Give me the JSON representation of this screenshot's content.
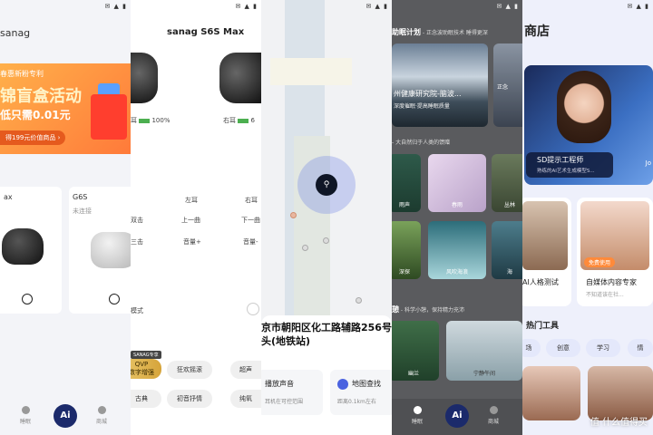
{
  "status_icons": "✉ ▲ ▮",
  "p1": {
    "title": "sanag",
    "banner": {
      "line1": "春惠新粉专利",
      "line2": "锦盲盒活动",
      "line3": "低只需0.01元",
      "cta": "得199元价值商品 ›"
    },
    "devices": [
      {
        "name": "ax",
        "status": ""
      },
      {
        "name": "G6S",
        "status": "未连接"
      }
    ],
    "nav": {
      "sleep": "睡眠",
      "ai": "Ai",
      "mall": "商城"
    }
  },
  "p2": {
    "title": "sanag S6S Max",
    "left_ear": "耳",
    "left_batt": "100%",
    "right_ear": "右耳",
    "right_batt": "6",
    "col_left": "左耳",
    "col_right": "右耳",
    "rows": [
      {
        "label": "双击",
        "left": "上一曲",
        "right": "下一曲"
      },
      {
        "label": "三击",
        "left": "音量+",
        "right": "音量-"
      }
    ],
    "mode_label": "模式",
    "gold_tag": "SANAG专享",
    "chips": [
      "QVP\n数字增强",
      "狂欢摇滚",
      "超声",
      "古典",
      "初音抒情",
      "纯氧"
    ]
  },
  "p3": {
    "address": "京市朝阳区化工路辅路256号\n头(地铁站)",
    "actions": [
      {
        "title": "播放声音",
        "desc": "耳机在可控范围"
      },
      {
        "title": "地图查找",
        "desc": "距离0.1km左右"
      }
    ]
  },
  "p4": {
    "sec1_title": "助眠计划",
    "sec1_sub": " - 正念波助眠技术 睡得更深",
    "hero_title": "州健康研究院-脑波...",
    "hero_desc": "深度催眠·提高睡眠质量",
    "hero_side": "正念",
    "sec2_sub": "- 大自然归于人类的馈赠",
    "nature": [
      "雨声",
      "春雨",
      "丛林",
      "深探",
      "风吹海浪",
      "海"
    ],
    "sec3_title": "憩",
    "sec3_sub": " - 科学小憩，保持精力充沛",
    "nap": [
      "幽兰",
      "宁静午间"
    ],
    "nav": {
      "sleep": "睡眠",
      "ai": "Ai",
      "mall": "商城"
    }
  },
  "p5": {
    "title": "商店",
    "hero_name": "SD提示工程师",
    "hero_desc": "熟练的AI艺术生成模型S...",
    "hero_side": "Jo",
    "products": [
      {
        "name": "AI人格测试",
        "desc": "",
        "tag": ""
      },
      {
        "name": "自媒体内容专家",
        "desc": "不知道该在社...",
        "tag": "免费使用"
      }
    ],
    "section": "热门工具",
    "tools": [
      "场",
      "创意",
      "学习",
      "情"
    ],
    "watermark": "值 什么值得买"
  }
}
